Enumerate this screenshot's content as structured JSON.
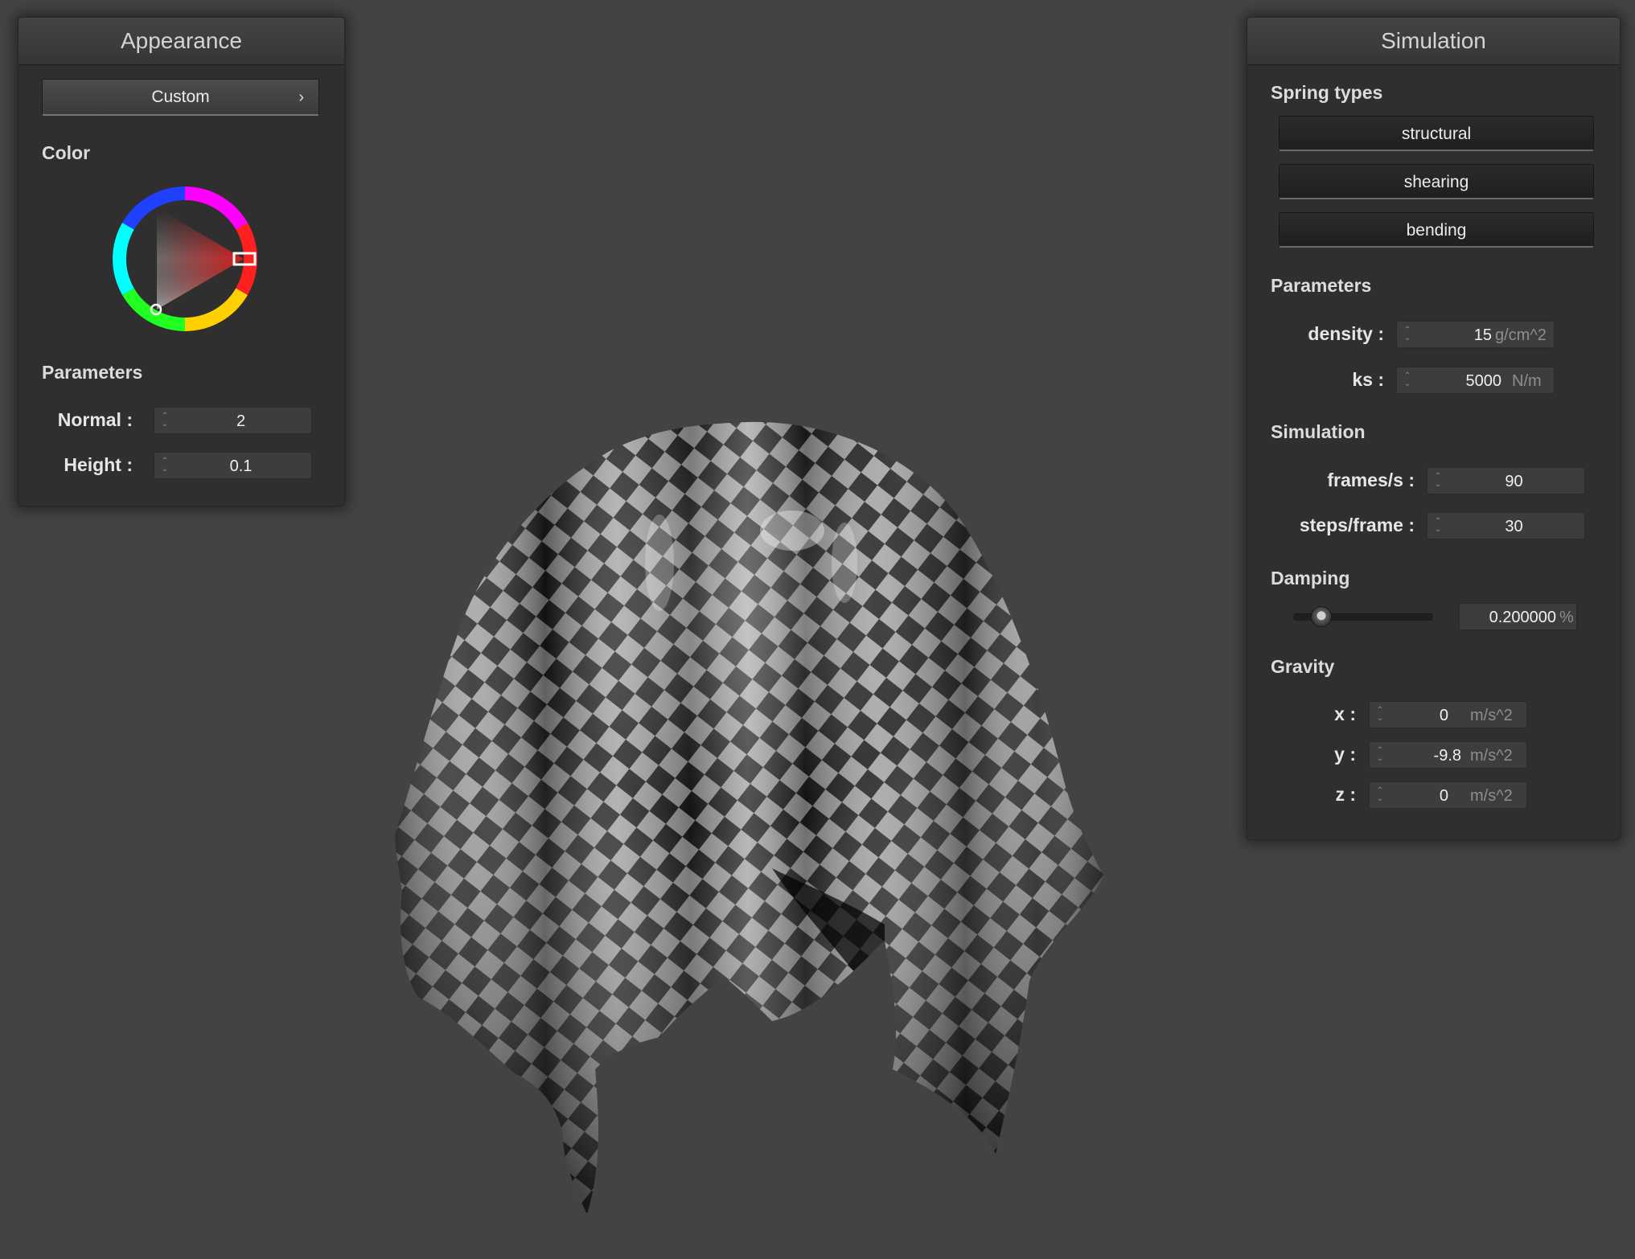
{
  "appearance": {
    "title": "Appearance",
    "preset_label": "Custom",
    "preset_chevron": "›",
    "color_label": "Color",
    "color_value": "#d11d1d",
    "parameters_label": "Parameters",
    "normal_label": "Normal :",
    "normal_value": "2",
    "height_label": "Height :",
    "height_value": "0.1"
  },
  "simulation": {
    "title": "Simulation",
    "spring_types_label": "Spring types",
    "spring_buttons": [
      "structural",
      "shearing",
      "bending"
    ],
    "parameters_label": "Parameters",
    "density_label": "density :",
    "density_value": "15",
    "density_unit": "g/cm^2",
    "ks_label": "ks :",
    "ks_value": "5000",
    "ks_unit": "N/m",
    "simulation_label": "Simulation",
    "fps_label": "frames/s :",
    "fps_value": "90",
    "steps_label": "steps/frame :",
    "steps_value": "30",
    "damping_label": "Damping",
    "damping_value": "0.200000",
    "damping_unit": "%",
    "damping_slider_level": 0.2,
    "gravity_label": "Gravity",
    "gx_label": "x :",
    "gx_value": "0",
    "gx_unit": "m/s^2",
    "gy_label": "y :",
    "gy_value": "-9.8",
    "gy_unit": "m/s^2",
    "gz_label": "z :",
    "gz_value": "0",
    "gz_unit": "m/s^2"
  },
  "icons": {
    "spin_arrows": "spinner-arrows-icon",
    "chevron": "chevron-right-icon"
  }
}
